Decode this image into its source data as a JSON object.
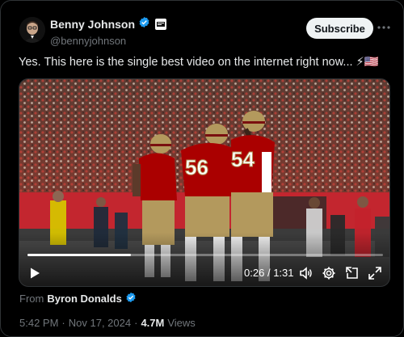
{
  "author": {
    "display_name": "Benny Johnson",
    "handle": "@bennyjohnson",
    "verified": true
  },
  "subscribe_label": "Subscribe",
  "more_icon": "more-dots-icon",
  "post": {
    "text": "Yes. This here is the single best video on the internet right now...",
    "emoji": "⚡🇺🇸"
  },
  "video": {
    "current_time": "0:26",
    "separator": "/",
    "duration": "1:31",
    "progress_fraction": 0.29,
    "jersey_numbers": [
      "56",
      "54"
    ]
  },
  "from": {
    "prefix": "From",
    "name": "Byron Donalds",
    "verified": true
  },
  "meta": {
    "time": "5:42 PM",
    "dot1": "·",
    "date": "Nov 17, 2024",
    "dot2": "·",
    "views_count": "4.7M",
    "views_label": "Views"
  },
  "colors": {
    "background": "#000000",
    "verified_blue": "#1d9bf0",
    "niners_red": "#aa0000",
    "niners_gold": "#b3995d"
  }
}
